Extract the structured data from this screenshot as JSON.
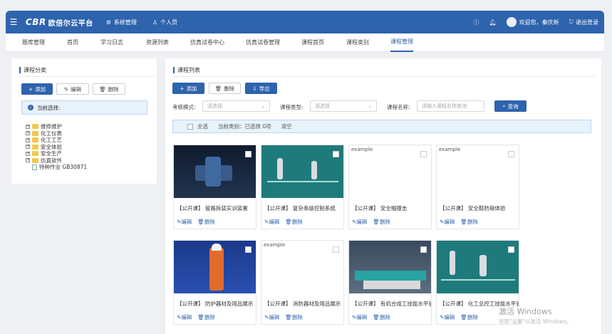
{
  "header": {
    "logo_mark": "CBR",
    "app_name": "欧倍尔云平台",
    "nav": [
      {
        "label": "系统管理",
        "icon": "gear-icon"
      },
      {
        "label": "个人页",
        "icon": "user-icon"
      }
    ],
    "welcome": "欢迎您，秦庆新",
    "logout": "退出登录",
    "accent": "#2e63ad"
  },
  "tabs": [
    {
      "label": "题库管理",
      "active": false
    },
    {
      "label": "首页",
      "active": false
    },
    {
      "label": "学习日志",
      "active": false
    },
    {
      "label": "资源列表",
      "active": false
    },
    {
      "label": "仿真试卷中心",
      "active": false
    },
    {
      "label": "仿真试卷管理",
      "active": false
    },
    {
      "label": "课程首页",
      "active": false
    },
    {
      "label": "课程类别",
      "active": false
    },
    {
      "label": "课程管理",
      "active": true
    }
  ],
  "left": {
    "title": "课程分类",
    "add": "添加",
    "edit": "编辑",
    "delete": "删除",
    "current_label": "当前选择:",
    "tree": [
      {
        "label": "维修维护",
        "type": "folder"
      },
      {
        "label": "化工仪表",
        "type": "folder"
      },
      {
        "label": "化工工艺",
        "type": "folder"
      },
      {
        "label": "安全体验",
        "type": "folder"
      },
      {
        "label": "安全生产",
        "type": "folder"
      },
      {
        "label": "仿真软件",
        "type": "folder"
      },
      {
        "label": "特种作业 GB30871",
        "type": "doc"
      }
    ]
  },
  "right": {
    "title": "课程列表",
    "add": "添加",
    "delete": "删除",
    "export": "导出",
    "filters": {
      "mode_label": "考核模式:",
      "mode_placeholder": "请选择",
      "type_label": "课程类型:",
      "type_placeholder": "请选择",
      "name_label": "课程名称:",
      "name_placeholder": "请输入课程名称查询",
      "query": "查询"
    },
    "selection": {
      "all": "全选",
      "current": "当前类别：已选择 0项",
      "clear": "清空"
    },
    "cards": [
      {
        "title": "【公开课】 管路拆装实训装置",
        "alt": "",
        "edit": "编辑",
        "delete": "删除"
      },
      {
        "title": "【公开课】 复杂串级控制系统",
        "alt": "",
        "edit": "编辑",
        "delete": "删除"
      },
      {
        "title": "【公开课】 安全帽撞击",
        "alt": "example",
        "edit": "编辑",
        "delete": "删除"
      },
      {
        "title": "【公开课】 安全鞋防砸体验",
        "alt": "example",
        "edit": "编辑",
        "delete": "删除"
      },
      {
        "title": "【公开课】 防护器材及用品展示",
        "alt": "",
        "edit": "编辑",
        "delete": "删除"
      },
      {
        "title": "【公开课】 消防器材及用品展示",
        "alt": "example",
        "edit": "编辑",
        "delete": "删除"
      },
      {
        "title": "【公开课】 有机合成工技能水平鉴",
        "alt": "",
        "edit": "编辑",
        "delete": "删除"
      },
      {
        "title": "【公开课】 化工总控工技能水平鉴",
        "alt": "",
        "edit": "编辑",
        "delete": "删除"
      }
    ]
  },
  "watermark": {
    "line1": "激活 Windows",
    "line2": "转到\"设置\"以激活 Windows。"
  }
}
